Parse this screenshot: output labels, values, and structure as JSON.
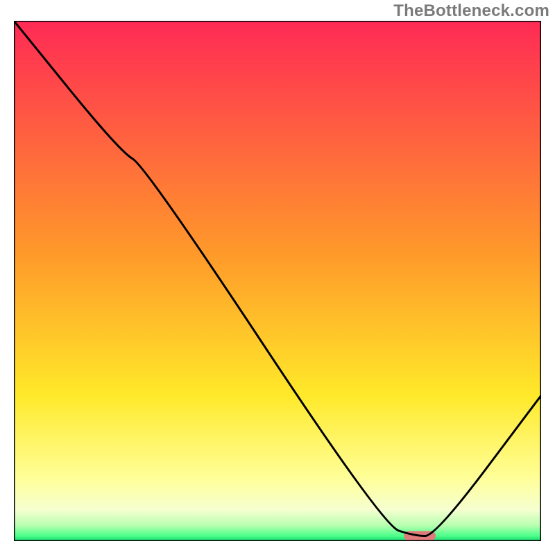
{
  "watermark": "TheBottleneck.com",
  "chart_data": {
    "type": "line",
    "title": "",
    "xlabel": "",
    "ylabel": "",
    "xlim": [
      0,
      100
    ],
    "ylim": [
      0,
      100
    ],
    "grid": false,
    "background": "rainbow-gradient",
    "series": [
      {
        "name": "bottleneck-curve",
        "x": [
          0,
          20,
          25,
          70,
          76,
          80,
          100
        ],
        "values": [
          100,
          75,
          72,
          3,
          1,
          1,
          28
        ],
        "color": "#000000"
      }
    ],
    "marker": {
      "name": "optimal-segment",
      "x_start": 74,
      "x_end": 80,
      "y": 1,
      "color": "#e07b7b"
    },
    "gradient_stops": [
      {
        "offset": 0,
        "color": "#ff2a55"
      },
      {
        "offset": 45,
        "color": "#ff9a2a"
      },
      {
        "offset": 72,
        "color": "#ffe92a"
      },
      {
        "offset": 88,
        "color": "#ffff99"
      },
      {
        "offset": 94,
        "color": "#f5ffd0"
      },
      {
        "offset": 97,
        "color": "#b8ffb0"
      },
      {
        "offset": 99,
        "color": "#4bff8a"
      },
      {
        "offset": 100,
        "color": "#17d46b"
      }
    ]
  }
}
